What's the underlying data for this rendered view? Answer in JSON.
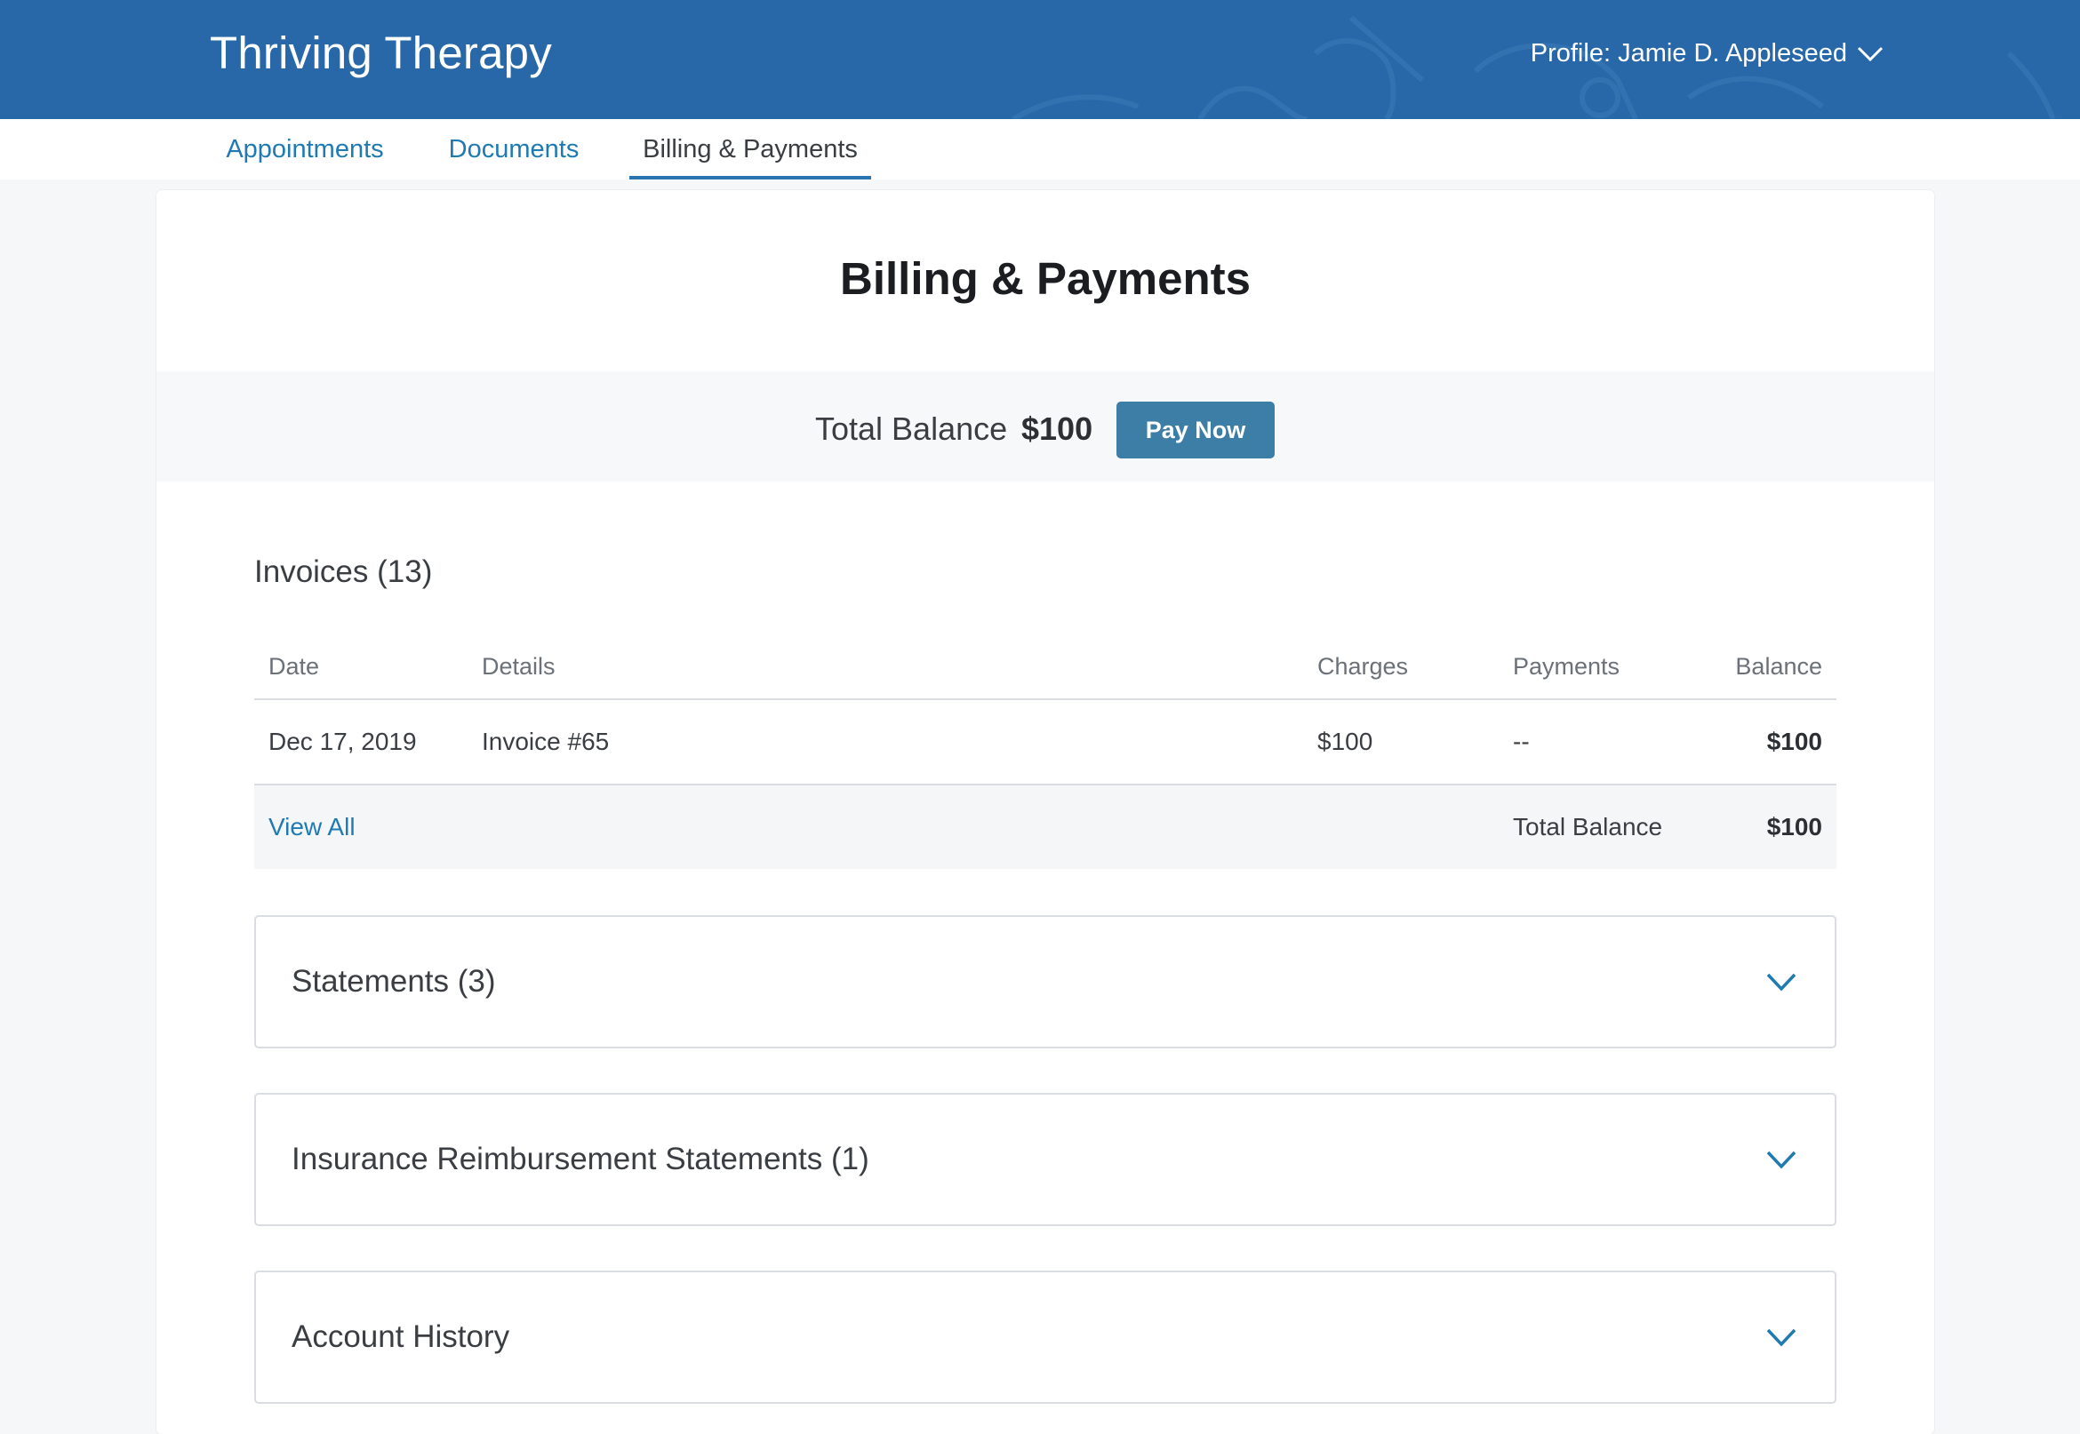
{
  "header": {
    "brand": "Thriving Therapy",
    "profile_label": "Profile: Jamie D. Appleseed"
  },
  "nav": {
    "tabs": [
      {
        "label": "Appointments",
        "active": false
      },
      {
        "label": "Documents",
        "active": false
      },
      {
        "label": "Billing & Payments",
        "active": true
      }
    ]
  },
  "page": {
    "title": "Billing & Payments",
    "balance_label": "Total Balance",
    "balance_amount": "$100",
    "pay_button": "Pay Now"
  },
  "invoices": {
    "title": "Invoices (13)",
    "columns": [
      "Date",
      "Details",
      "Charges",
      "Payments",
      "Balance"
    ],
    "rows": [
      {
        "date": "Dec 17, 2019",
        "details": "Invoice #65",
        "charges": "$100",
        "payments": "--",
        "balance": "$100"
      }
    ],
    "footer": {
      "view_all": "View All",
      "total_label": "Total Balance",
      "total_amount": "$100"
    }
  },
  "sections": [
    {
      "title": "Statements (3)",
      "icon": "chevron-down-icon"
    },
    {
      "title": "Insurance Reimbursement Statements (1)",
      "icon": "chevron-down-icon"
    },
    {
      "title": "Account History",
      "icon": "chevron-down-icon"
    }
  ],
  "colors": {
    "header_bg": "#2868a8",
    "link": "#1f7ab4",
    "button_bg": "#3d7ea6",
    "page_bg": "#f6f7f9"
  }
}
